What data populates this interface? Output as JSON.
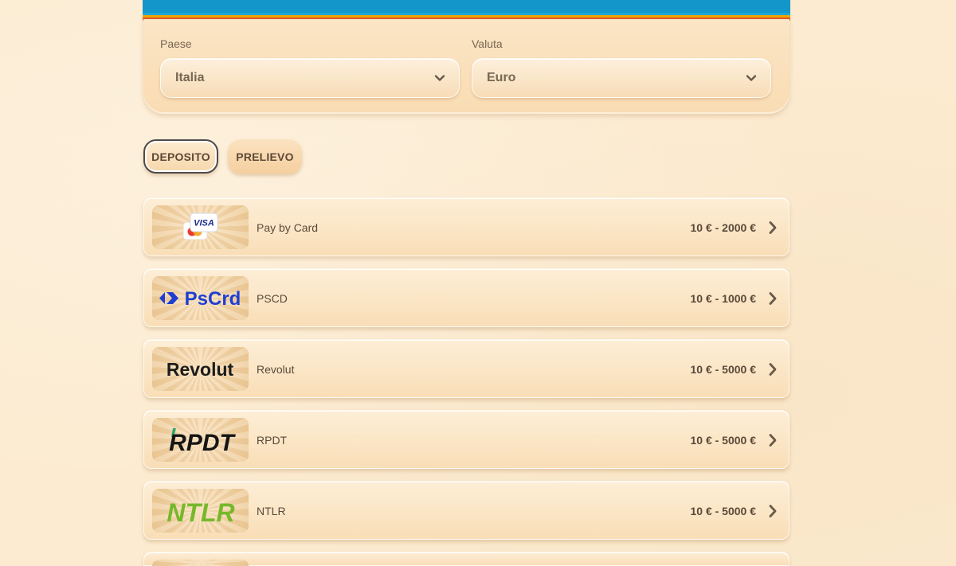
{
  "filters": {
    "country": {
      "label": "Paese",
      "value": "Italia"
    },
    "currency": {
      "label": "Valuta",
      "value": "Euro"
    }
  },
  "tabs": [
    {
      "label": "DEPOSITO",
      "active": true
    },
    {
      "label": "PRELIEVO",
      "active": false
    }
  ],
  "methods": [
    {
      "name": "Pay by Card",
      "range": "10 € - 2000 €",
      "logo": "visa-mastercard-logo"
    },
    {
      "name": "PSCD",
      "range": "10 € - 1000 €",
      "logo": "pscrd-logo",
      "logo_text": "PsCrd"
    },
    {
      "name": "Revolut",
      "range": "10 € - 5000 €",
      "logo": "revolut-logo",
      "logo_text": "Revolut"
    },
    {
      "name": "RPDT",
      "range": "10 € - 5000 €",
      "logo": "rpdt-logo",
      "logo_text": "RPDT"
    },
    {
      "name": "NTLR",
      "range": "10 € - 5000 €",
      "logo": "ntlr-logo",
      "logo_text": "NTLR"
    }
  ],
  "colors": {
    "background": "#fcebd0",
    "banner_blue": "#1396c9",
    "pscrd_blue": "#1f3fd1",
    "ntlr_green": "#76b82a",
    "text": "#5b4a3a"
  }
}
